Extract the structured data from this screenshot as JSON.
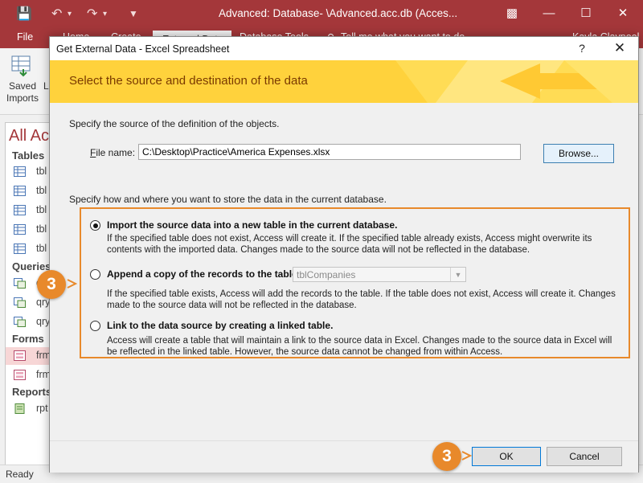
{
  "app": {
    "title": "Advanced: Database- \\Advanced.acc.db (Acces...",
    "user": "Kayla Claypool",
    "tabs": [
      "File",
      "Home",
      "Create",
      "External Data",
      "Database Tools"
    ],
    "tell_me": "Tell me what you want to do",
    "ribbon_saved_imports": "Saved\nImports",
    "nav": {
      "title": "All Ac",
      "categories": [
        "Tables",
        "Queries",
        "Forms",
        "Reports"
      ],
      "table_items": [
        "tbl",
        "tbl",
        "tbl",
        "tbl",
        "tbl"
      ],
      "query_items": [
        "q",
        "qry",
        "qry"
      ],
      "form_items": [
        "frm",
        "frm"
      ],
      "report_items": [
        "rpt"
      ]
    },
    "status": "Ready"
  },
  "dialog": {
    "title": "Get External Data - Excel Spreadsheet",
    "help": "?",
    "close": "✕",
    "banner": "Select the source and destination of the data",
    "source_instruction": "Specify the source of the definition of the objects.",
    "file_label": "File name:",
    "file_value": "C:\\Desktop\\Practice\\America Expenses.xlsx",
    "browse": "Browse...",
    "store_instruction": "Specify how and where you want to store the data in the current database.",
    "options": [
      {
        "label": "Import the source data into a new table in the current database.",
        "desc": "If the specified table does not exist, Access will create it. If the specified table already exists, Access might overwrite its contents with the imported data. Changes made to the source data will not be reflected in the database.",
        "selected": true
      },
      {
        "label": "Append a copy of the records to the table:",
        "desc": "If the specified table exists, Access will add the records to the table. If the table does not exist, Access will create it. Changes made to the source data will not be reflected in the database.",
        "selected": false
      },
      {
        "label": "Link to the data source by creating a linked table.",
        "desc": "Access will create a table that will maintain a link to the source data in Excel. Changes made to the source data in Excel will be reflected in the linked table. However, the source data cannot be changed from within Access.",
        "selected": false
      }
    ],
    "append_table": "tblCompanies",
    "ok": "OK",
    "cancel": "Cancel"
  },
  "callouts": [
    "3",
    "3"
  ],
  "colors": {
    "access_red": "#a4373a",
    "banner_yellow": "#ffd23c",
    "callout_orange": "#e8892b"
  }
}
